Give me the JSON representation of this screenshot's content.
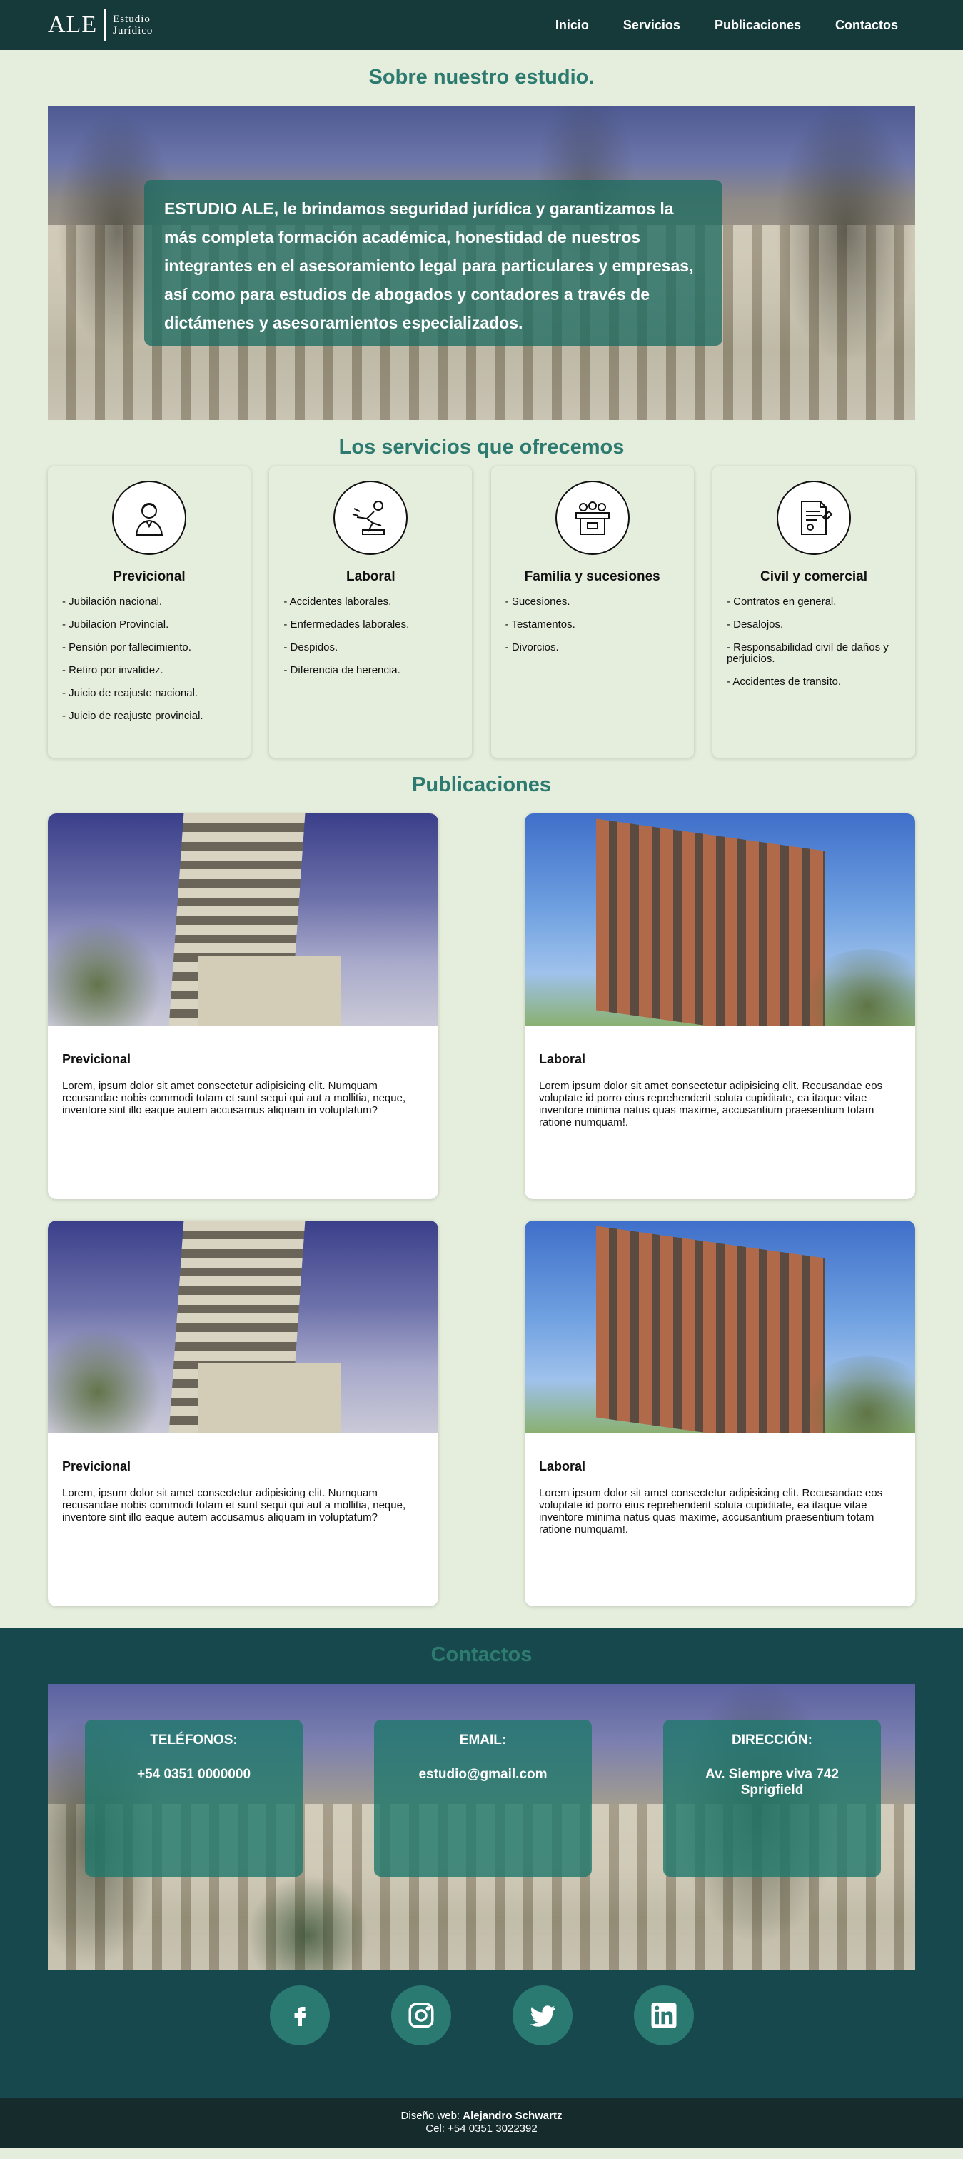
{
  "header": {
    "logo_main": "ALE",
    "logo_line1": "Estudio",
    "logo_line2": "Jurídico",
    "nav": [
      {
        "label": "Inicio"
      },
      {
        "label": "Servicios"
      },
      {
        "label": "Publicaciones"
      },
      {
        "label": "Contactos"
      }
    ]
  },
  "about": {
    "title": "Sobre nuestro estudio.",
    "text": "ESTUDIO ALE, le brindamos seguridad jurídica y garantizamos la más completa formación académica, honestidad de nuestros integrantes en el asesoramiento legal para particulares y empresas, así como para estudios de abogados y contadores a través de dictámenes y asesoramientos especializados."
  },
  "services": {
    "title": "Los servicios que ofrecemos",
    "cards": [
      {
        "icon": "lawyer-icon",
        "title": "Previcional",
        "items": [
          "- Jubilación nacional.",
          "- Jubilacion Provincial.",
          "- Pensión por fallecimiento.",
          "- Retiro por invalidez.",
          "- Juicio de reajuste nacional.",
          "- Juicio de reajuste provincial."
        ]
      },
      {
        "icon": "accident-icon",
        "title": "Laboral",
        "items": [
          "- Accidentes laborales.",
          "- Enfermedades laborales.",
          "- Despidos.",
          "- Diferencia de herencia."
        ]
      },
      {
        "icon": "court-icon",
        "title": "Familia y sucesiones",
        "items": [
          "- Sucesiones.",
          "- Testamentos.",
          "- Divorcios."
        ]
      },
      {
        "icon": "document-icon",
        "title": "Civil y comercial",
        "items": [
          "- Contratos en general.",
          "- Desalojos.",
          "- Responsabilidad civil de daños y perjuicios.",
          "- Accidentes de transito."
        ]
      }
    ]
  },
  "publications": {
    "title": "Publicaciones",
    "cards": [
      {
        "title": "Previcional",
        "text": "Lorem, ipsum dolor sit amet consectetur adipisicing elit. Numquam recusandae nobis commodi totam et sunt sequi qui aut a mollitia, neque, inventore sint illo eaque autem accusamus aliquam in voluptatum?"
      },
      {
        "title": "Laboral",
        "text": "Lorem ipsum dolor sit amet consectetur adipisicing elit. Recusandae eos voluptate id porro eius reprehenderit soluta cupiditate, ea itaque vitae inventore minima natus quas maxime, accusantium praesentium totam ratione numquam!."
      },
      {
        "title": "Previcional",
        "text": "Lorem, ipsum dolor sit amet consectetur adipisicing elit. Numquam recusandae nobis commodi totam et sunt sequi qui aut a mollitia, neque, inventore sint illo eaque autem accusamus aliquam in voluptatum?"
      },
      {
        "title": "Laboral",
        "text": "Lorem ipsum dolor sit amet consectetur adipisicing elit. Recusandae eos voluptate id porro eius reprehenderit soluta cupiditate, ea itaque vitae inventore minima natus quas maxime, accusantium praesentium totam ratione numquam!."
      }
    ]
  },
  "contacts": {
    "title": "Contactos",
    "phone_label": "TELÉFONOS:",
    "phone_value": "+54 0351 0000000",
    "email_label": "EMAIL:",
    "email_value": "estudio@gmail.com",
    "address_label": "DIRECCIÓN:",
    "address_value": "Av. Siempre viva 742 Sprigfield",
    "socials": [
      "facebook-icon",
      "instagram-icon",
      "twitter-icon",
      "linkedin-icon"
    ]
  },
  "footer": {
    "design_label": "Diseño web:",
    "designer": "Alejandro Schwartz",
    "phone": "Cel: +54 0351 3022392"
  },
  "colors": {
    "header_bg": "#16393a",
    "page_bg": "#e5eddc",
    "accent": "#2d7a70",
    "contacts_bg": "#16484d",
    "footer_bg": "#152b2c"
  }
}
